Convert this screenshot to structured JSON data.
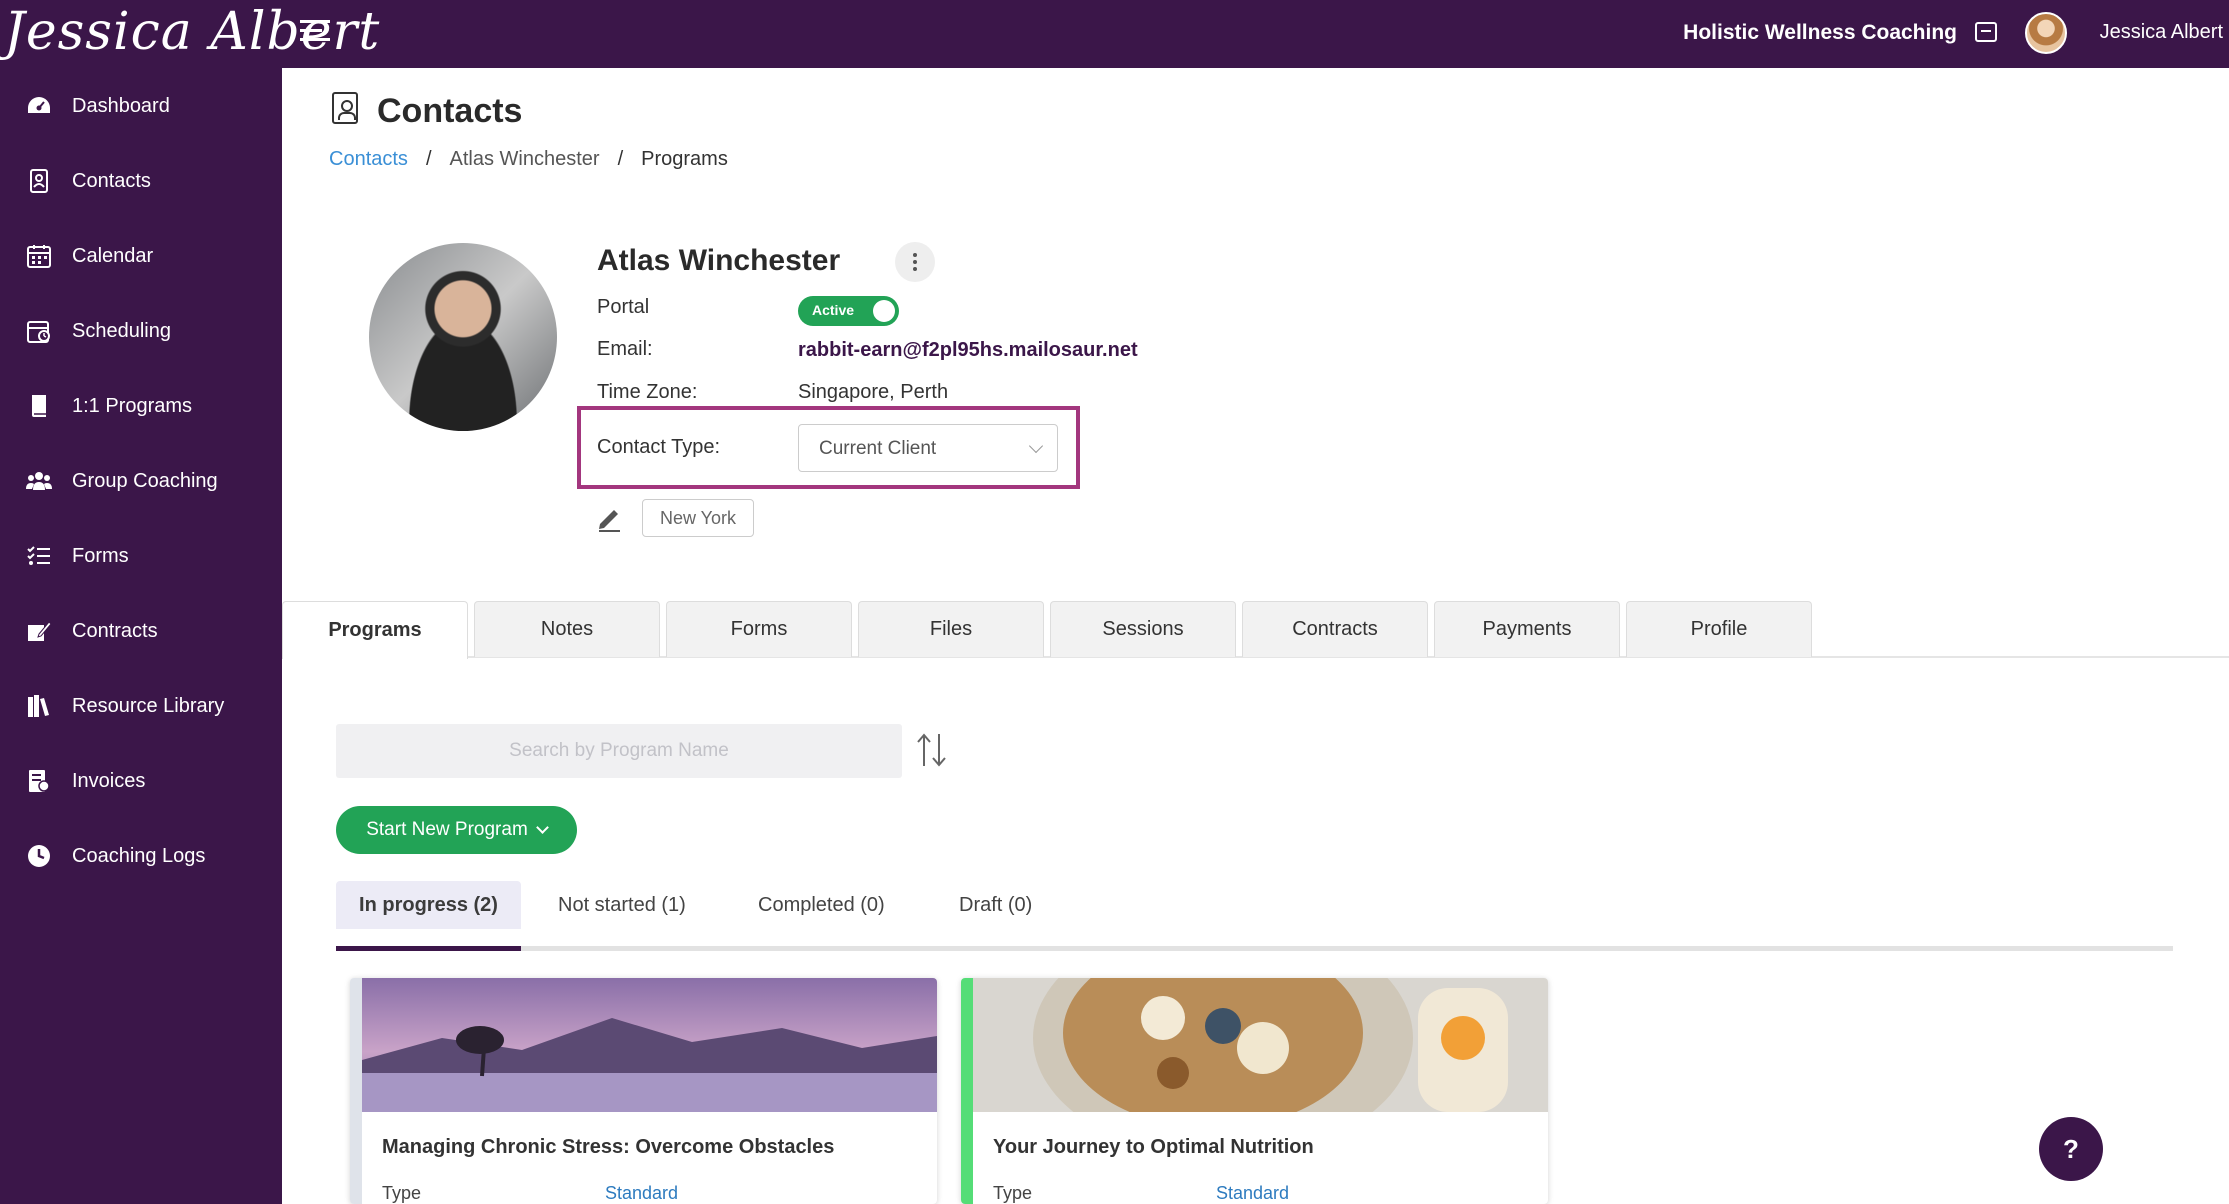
{
  "header": {
    "logo_text": "Jessica Albert",
    "business_name": "Holistic Wellness Coaching",
    "user_name": "Jessica Albert"
  },
  "sidebar": {
    "items": [
      {
        "label": "Dashboard",
        "icon": "dashboard-icon"
      },
      {
        "label": "Contacts",
        "icon": "contacts-icon"
      },
      {
        "label": "Calendar",
        "icon": "calendar-icon"
      },
      {
        "label": "Scheduling",
        "icon": "scheduling-icon"
      },
      {
        "label": "1:1 Programs",
        "icon": "book-icon"
      },
      {
        "label": "Group Coaching",
        "icon": "group-icon"
      },
      {
        "label": "Forms",
        "icon": "forms-icon"
      },
      {
        "label": "Contracts",
        "icon": "contract-icon"
      },
      {
        "label": "Resource Library",
        "icon": "library-icon"
      },
      {
        "label": "Invoices",
        "icon": "invoice-icon"
      },
      {
        "label": "Coaching Logs",
        "icon": "clock-icon"
      }
    ]
  },
  "page": {
    "title": "Contacts",
    "breadcrumb": {
      "root": "Contacts",
      "contact": "Atlas Winchester",
      "current": "Programs",
      "separator": "/"
    }
  },
  "contact": {
    "name": "Atlas Winchester",
    "portal_label": "Portal",
    "portal_status": "Active",
    "email_label": "Email:",
    "email": "rabbit-earn@f2pl95hs.mailosaur.net",
    "timezone_label": "Time Zone:",
    "timezone": "Singapore, Perth",
    "contact_type_label": "Contact Type:",
    "contact_type": "Current Client",
    "tag": "New York"
  },
  "tabs": [
    "Programs",
    "Notes",
    "Forms",
    "Files",
    "Sessions",
    "Contracts",
    "Payments",
    "Profile"
  ],
  "programs": {
    "search_placeholder": "Search by Program Name",
    "start_button": "Start New Program",
    "status_tabs": [
      "In progress (2)",
      "Not started (1)",
      "Completed (0)",
      "Draft (0)"
    ],
    "cards": [
      {
        "title": "Managing Chronic Stress: Overcome Obstacles",
        "type_label": "Type",
        "type_value": "Standard",
        "accent": "#dfe3ea"
      },
      {
        "title": "Your Journey to Optimal Nutrition",
        "type_label": "Type",
        "type_value": "Standard",
        "accent": "#55dd77"
      }
    ]
  },
  "help_label": "?",
  "colors": {
    "brand": "#3b1649",
    "success": "#22a356",
    "link": "#3a8fd6",
    "highlight": "#a3367e"
  }
}
